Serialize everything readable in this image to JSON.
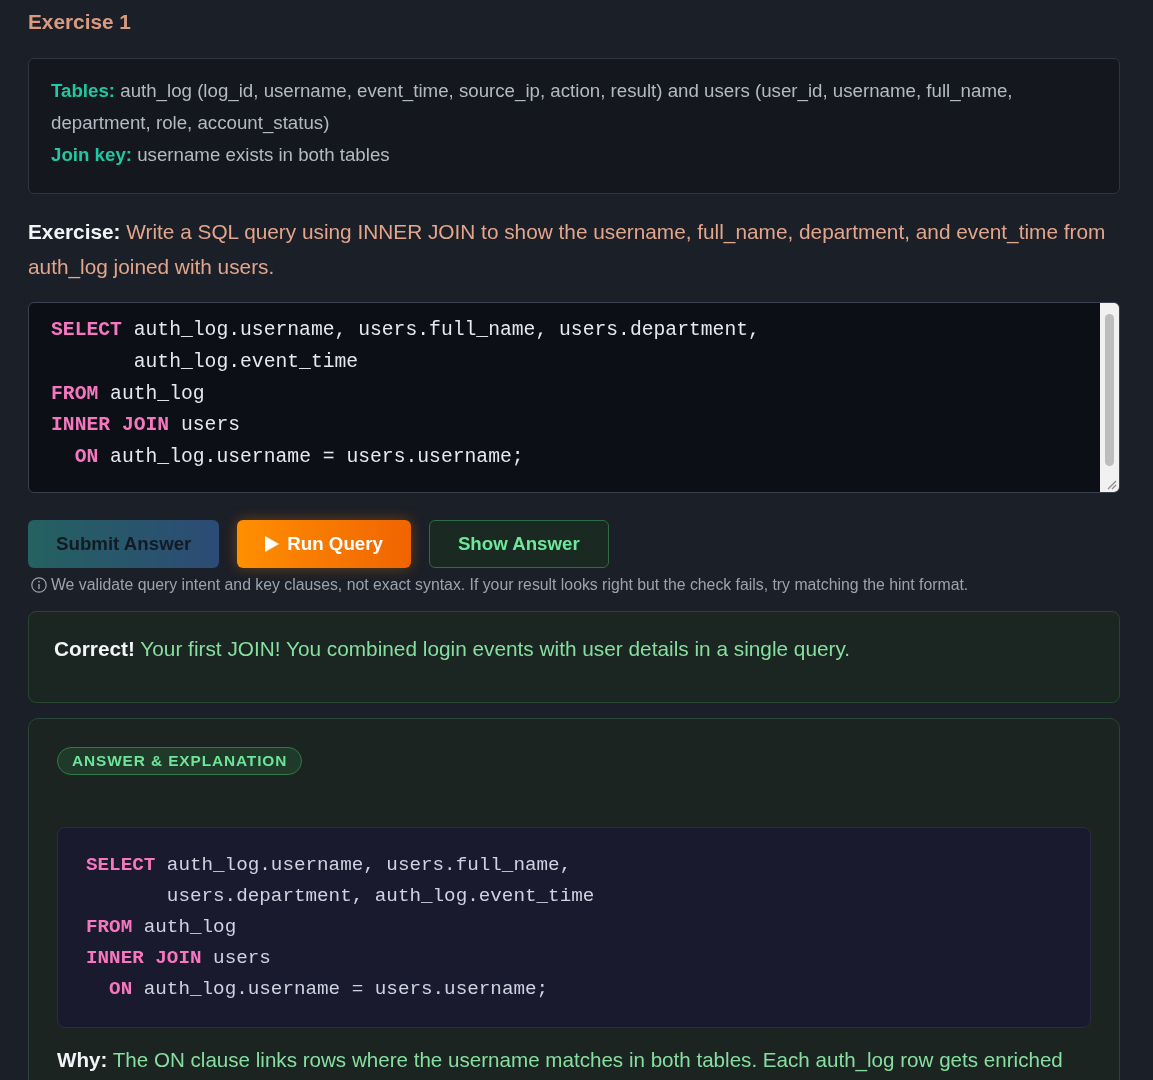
{
  "exercise": {
    "title": "Exercise 1"
  },
  "schema": {
    "lines": [
      {
        "label": "Tables:",
        "text": "auth_log (log_id, username, event_time, source_ip, action, result) and users (user_id, username, full_name, department, role, account_status)"
      },
      {
        "label": "Join key:",
        "text": "username exists in both tables"
      }
    ]
  },
  "prompt": {
    "label": "Exercise:",
    "text": "Write a SQL query using INNER JOIN to show the username, full_name, department, and event_time from auth_log joined with users."
  },
  "editor": {
    "lines": [
      "**SELECT** auth_log.username, users.full_name, users.department,",
      "       auth_log.event_time",
      "**FROM** auth_log",
      "**INNER JOIN** users",
      "  **ON** auth_log.username = users.username;"
    ]
  },
  "buttons": [
    {
      "kind": "submit",
      "label": "Submit Answer",
      "disabled": true
    },
    {
      "kind": "run",
      "label": "Run Query",
      "disabled": false
    },
    {
      "kind": "reveal",
      "label": "Show Answer",
      "disabled": false
    }
  ],
  "hint": "We validate query intent and key clauses, not exact syntax. If your result looks right but the check fails, try matching the hint format.",
  "feedback": {
    "correct": true,
    "label": "Correct!",
    "text": "Your first JOIN! You combined login events with user details in a single query."
  },
  "answer": {
    "badge": "ANSWER & EXPLANATION",
    "code_lines": [
      "**SELECT** auth_log.username, users.full_name,",
      "       users.department, auth_log.event_time",
      "**FROM** auth_log",
      "**INNER JOIN** users",
      "  **ON** auth_log.username = users.username;"
    ],
    "why_label": "Why:",
    "why_text": "The ON clause links rows where the username matches in both tables. Each auth_log row gets enriched"
  }
}
